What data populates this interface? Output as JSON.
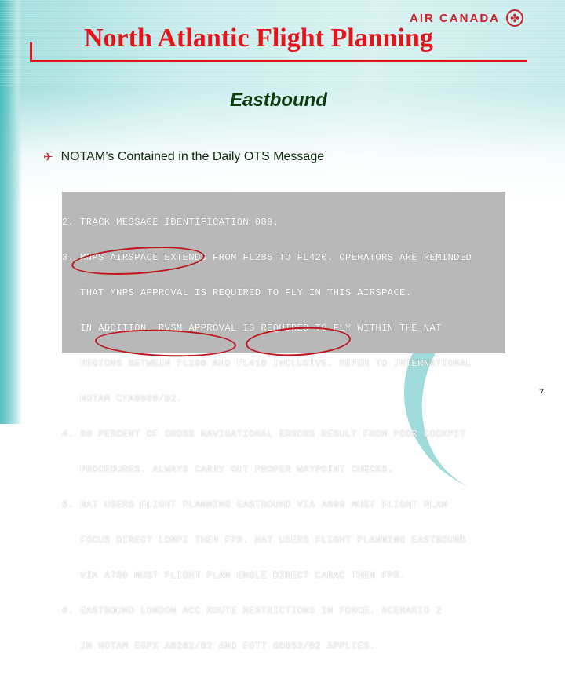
{
  "brand": {
    "logo_text": "AIR CANADA",
    "logo_icon": "maple-leaf-icon",
    "accent_color": "#e4141b"
  },
  "slide": {
    "title": "North Atlantic Flight Planning",
    "subtitle": "Eastbound",
    "bullet": {
      "icon": "airplane-icon",
      "text": "NOTAM’s Contained in the Daily OTS Message"
    },
    "notam_lines": [
      "2. TRACK MESSAGE IDENTIFICATION 089.",
      "3. MNPS AIRSPACE EXTENDS FROM FL285 TO FL420. OPERATORS ARE REMINDED",
      "   THAT MNPS APPROVAL IS REQUIRED TO FLY IN THIS AIRSPACE.",
      "   IN ADDITION, RVSM APPROVAL IS REQUIRED TO FLY WITHIN THE NAT",
      "   REGIONS BETWEEN FL290 AND FL410 INCLUSIVE. REFER TO INTERNATIONAL",
      "   NOTAM CYA0080/02.",
      "4. 80 PERCENT OF GROSS NAVIGATIONAL ERRORS RESULT FROM POOR COCKPIT",
      "   PROCEDURES. ALWAYS CARRY OUT PROPER WAYPOINT CHECKS.",
      "5. NAT USERS FLIGHT PLANNING EASTBOUND VIA A699 MUST FLIGHT PLAN",
      "   FOCUS DIRECT LOMPI THEN FPR. NAT USERS FLIGHT PLANNING EASTBOUND",
      "   VIA A700 MUST FLIGHT PLAN ENGLE DIRECT CARAC THEN FPR.",
      "6. EASTBOUND LONDON ACC ROUTE RESTRICTIONS IN FORCE. SCENARIO 2",
      "   IN NOTAM EGPX A0262/02 AND EGTT G0053/02 APPLIES."
    ],
    "highlighted_notams": [
      "NOTAM CYA0080/02",
      "NOTAM EGPX A0262/02",
      "EGTT G0053/02"
    ],
    "page_number": "7"
  }
}
